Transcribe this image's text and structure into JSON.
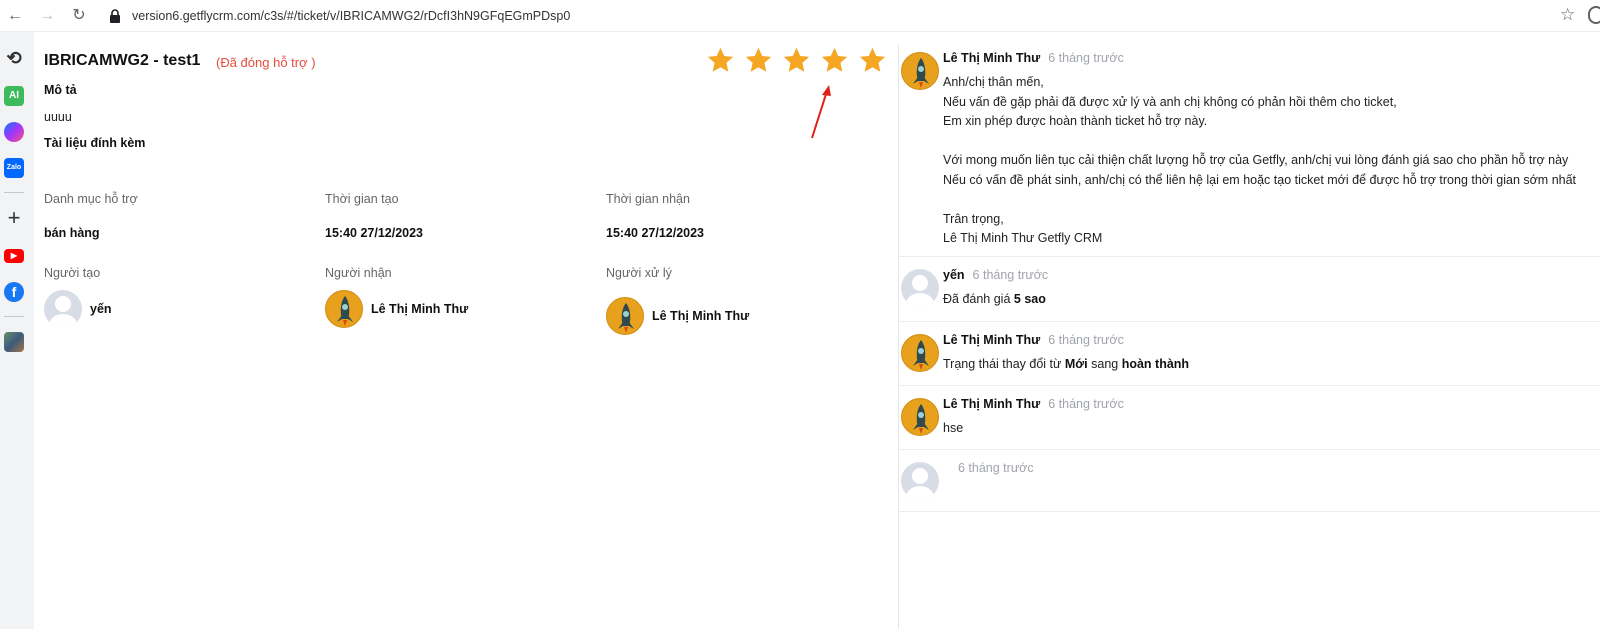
{
  "browser": {
    "url": "version6.getflycrm.com/c3s/#/ticket/v/IBRICAMWG2/rDcfI3hN9GFqEGmPDsp0",
    "back_glyph": "←",
    "forward_glyph": "→",
    "reload_glyph": "↻",
    "bookmark_glyph": "☆"
  },
  "sidebar": {
    "icons": [
      "history-icon",
      "ai-icon",
      "messenger-icon",
      "zalo-icon",
      "add-icon",
      "youtube-icon",
      "facebook-icon",
      "profile-icon"
    ],
    "ai_label": "AI",
    "zalo_label": "Zalo",
    "add_glyph": "+",
    "history_glyph": "⟲",
    "facebook_glyph": "f"
  },
  "ticket": {
    "title": "IBRICAMWG2 - test1",
    "status": "(Đã đóng hỗ trợ )",
    "description_label": "Mô tả",
    "description": "uuuu",
    "attachments_label": "Tài liệu đính kèm",
    "rating": 5,
    "fields": {
      "category_label": "Danh mục hỗ trợ",
      "category_value": "bán hàng",
      "created_label": "Thời gian tạo",
      "created_value": "15:40 27/12/2023",
      "received_label": "Thời gian nhận",
      "received_value": "15:40 27/12/2023",
      "creator_label": "Người tạo",
      "creator_name": "yến",
      "receiver_label": "Người nhận",
      "receiver_name": "Lê Thị Minh Thư",
      "handler_label": "Người xử lý",
      "handler_name": "Lê Thị Minh Thư"
    }
  },
  "comments": [
    {
      "author": "Lê Thị Minh Thư",
      "time": "6 tháng trước",
      "lines": [
        "Anh/chị thân mến,",
        "Nếu vấn đề gặp phải đã được xử lý và anh chị không có phản hồi thêm cho ticket,",
        "Em xin phép được hoàn thành ticket hỗ trợ này.",
        "",
        "Với mong muốn liên tục cải thiện chất lượng hỗ trợ của Getfly, anh/chị vui lòng đánh giá sao cho phần hỗ trợ này",
        "Nếu có vấn đề phát sinh, anh/chị có thể liên hệ lại em hoặc tạo ticket mới để được hỗ trợ trong thời gian sớm nhất",
        "",
        "Trân trọng,",
        "Lê Thị Minh Thư Getfly CRM"
      ]
    },
    {
      "author": "yến",
      "time": "6 tháng trước",
      "text_prefix": "Đã đánh giá ",
      "text_bold": "5 sao"
    },
    {
      "author": "Lê Thị Minh Thư",
      "time": "6 tháng trước",
      "text_prefix": "Trạng thái thay đổi từ ",
      "from": "Mới",
      "mid": " sang ",
      "to": "hoàn thành"
    },
    {
      "author": "Lê Thị Minh Thư",
      "time": "6 tháng trước",
      "text": "hse"
    },
    {
      "author": "",
      "time": "6 tháng trước"
    }
  ],
  "colors": {
    "star": "#f5a623",
    "status": "#e74c3c",
    "arrow": "#e3211c"
  }
}
